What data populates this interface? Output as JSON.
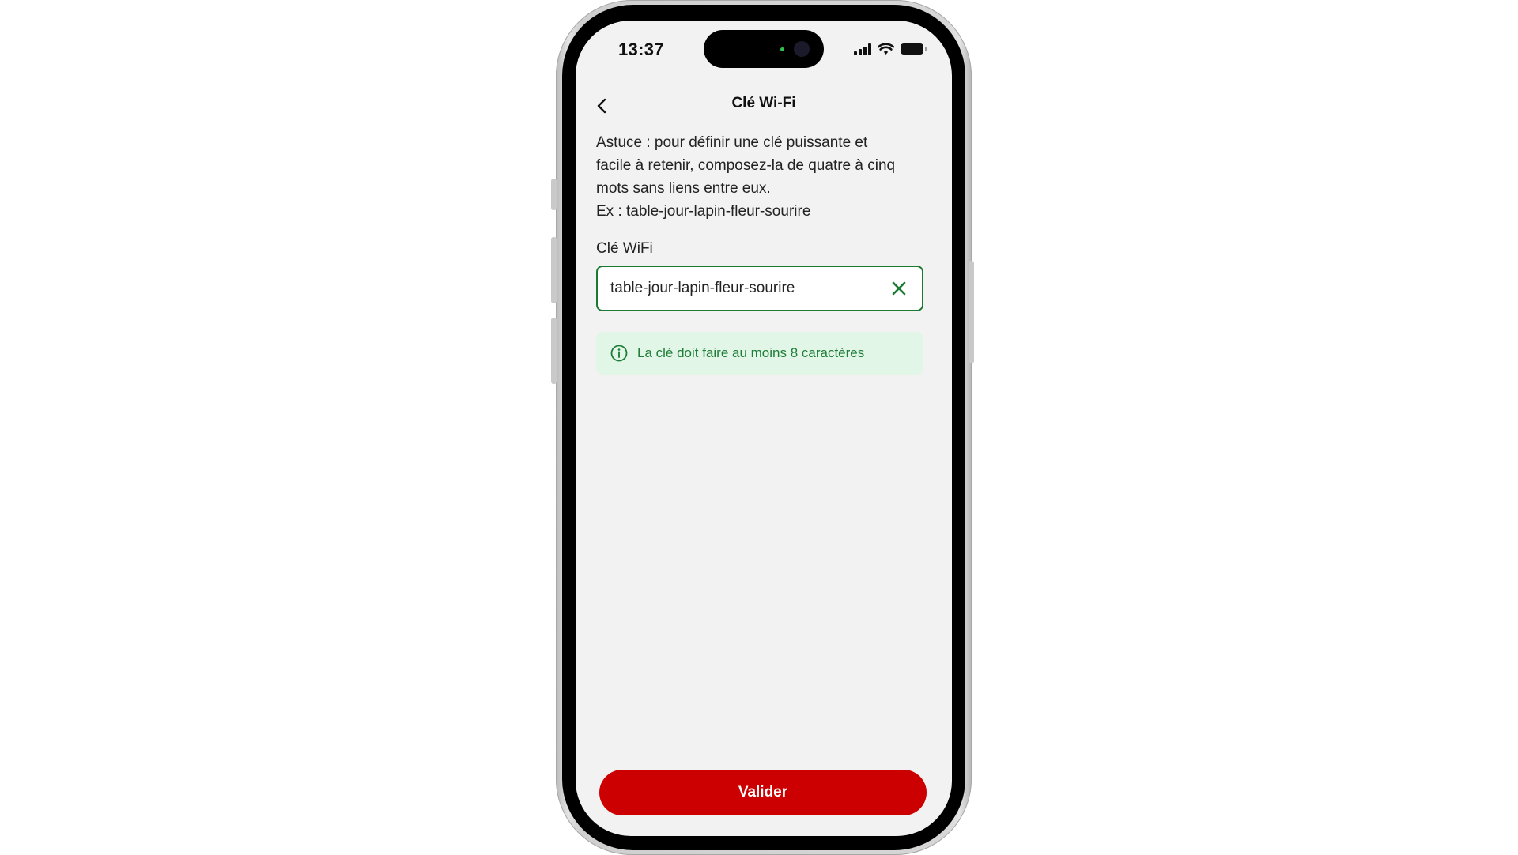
{
  "status_bar": {
    "time": "13:37"
  },
  "header": {
    "title": "Clé Wi-Fi",
    "back_icon": "chevron-left-icon"
  },
  "tip": {
    "lines": [
      "Astuce : pour définir une clé puissante et",
      "facile à retenir, composez-la de quatre à cinq",
      "mots sans liens entre eux.",
      "Ex : table-jour-lapin-fleur-sourire"
    ]
  },
  "wifi_key": {
    "label": "Clé WiFi",
    "value": "table-jour-lapin-fleur-sourire",
    "clear_icon": "close-icon",
    "border_color": "#1a7a32"
  },
  "info": {
    "icon": "info-icon",
    "message": "La clé doit faire au moins 8 caractères",
    "color": "#1e7d37",
    "background": "#e2f6e7"
  },
  "actions": {
    "validate_label": "Valider",
    "validate_color": "#cc0000"
  }
}
